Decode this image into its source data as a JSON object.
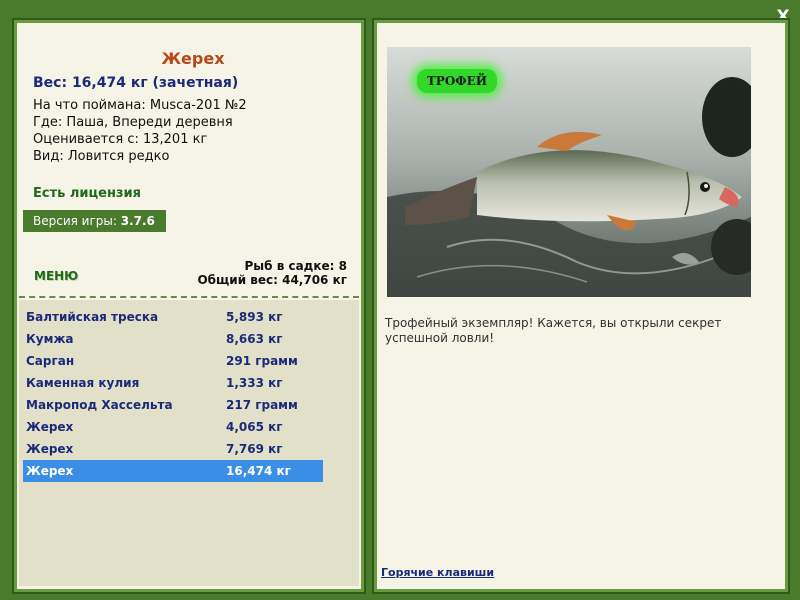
{
  "close_label": "X",
  "fish": {
    "title": "Жерех",
    "weight_line": "Вес: 16,474 кг (зачетная)",
    "caught_on": "На что поймана: Musca-201 №2",
    "where": "Где: Паша, Впереди деревня",
    "valued_from": "Оценивается с: 13,201 кг",
    "kind": "Вид: Ловится редко"
  },
  "license": "Есть лицензия",
  "version": {
    "label": "Версия игры:",
    "value": "3.7.6"
  },
  "menu_label": "МЕНЮ",
  "cage": {
    "count_line": "Рыб в садке: 8",
    "total_line": "Общий вес: 44,706 кг"
  },
  "catch_list": [
    {
      "name": "Балтийская треска",
      "weight": "5,893 кг"
    },
    {
      "name": "Кумжа",
      "weight": "8,663 кг"
    },
    {
      "name": "Сарган",
      "weight": "291 грамм"
    },
    {
      "name": "Каменная кулия",
      "weight": "1,333 кг"
    },
    {
      "name": "Макропод Хассельта",
      "weight": "217 грамм"
    },
    {
      "name": "Жерех",
      "weight": "4,065 кг"
    },
    {
      "name": "Жерех",
      "weight": "7,769 кг"
    },
    {
      "name": "Жерех",
      "weight": "16,474 кг",
      "selected": true
    }
  ],
  "trophy_badge": "ТРОФЕЙ",
  "description": "Трофейный экземпляр! Кажется, вы открыли секрет успешной ловли!",
  "hotkeys_label": "Горячие клавиши",
  "colors": {
    "frame_green": "#4a7a2c",
    "selected_row": "#3a8ee6",
    "title_orange": "#b8471a",
    "text_navy": "#1a2a7a"
  }
}
